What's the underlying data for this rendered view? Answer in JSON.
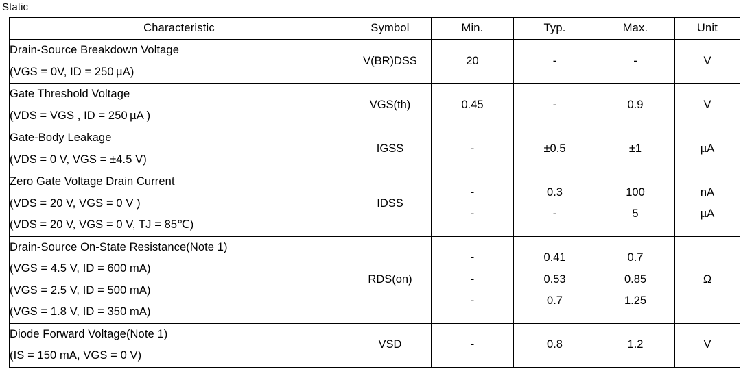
{
  "section": {
    "label": "Static"
  },
  "table": {
    "headers": {
      "characteristic": "Characteristic",
      "symbol": "Symbol",
      "min": "Min.",
      "typ": "Typ.",
      "max": "Max.",
      "unit": "Unit"
    },
    "rows": [
      {
        "characteristic": [
          "Drain-Source Breakdown Voltage",
          "(VGS = 0V, ID = 250 µA)"
        ],
        "symbol": "V(BR)DSS",
        "min": [
          "20"
        ],
        "typ": [
          "-"
        ],
        "max": [
          "-"
        ],
        "unit": [
          "V"
        ]
      },
      {
        "characteristic": [
          "Gate Threshold Voltage",
          "(VDS = VGS , ID = 250 µA )"
        ],
        "symbol": "VGS(th)",
        "min": [
          "0.45"
        ],
        "typ": [
          "-"
        ],
        "max": [
          "0.9"
        ],
        "unit": [
          "V"
        ]
      },
      {
        "characteristic": [
          "Gate-Body Leakage",
          "(VDS = 0 V, VGS = ±4.5 V)"
        ],
        "symbol": "IGSS",
        "min": [
          "-"
        ],
        "typ": [
          "±0.5"
        ],
        "max": [
          "±1"
        ],
        "unit": [
          "µA"
        ]
      },
      {
        "characteristic": [
          "Zero Gate Voltage Drain Current",
          "(VDS = 20 V, VGS = 0 V )",
          "(VDS = 20 V, VGS = 0 V, TJ = 85℃)"
        ],
        "symbol": "IDSS",
        "min": [
          "-",
          "-"
        ],
        "typ": [
          "0.3",
          "-"
        ],
        "max": [
          "100",
          "5"
        ],
        "unit": [
          "nA",
          "µA"
        ]
      },
      {
        "characteristic": [
          "Drain-Source On-State Resistance(Note 1)",
          "(VGS = 4.5 V, ID = 600 mA)",
          "(VGS = 2.5 V, ID = 500 mA)",
          "(VGS = 1.8 V, ID = 350 mA)"
        ],
        "symbol": "RDS(on)",
        "min": [
          "-",
          "-",
          "-"
        ],
        "typ": [
          "0.41",
          "0.53",
          "0.7"
        ],
        "max": [
          "0.7",
          "0.85",
          "1.25"
        ],
        "unit": [
          "Ω"
        ]
      },
      {
        "characteristic": [
          "Diode Forward Voltage(Note 1)",
          "(IS = 150 mA, VGS = 0 V)"
        ],
        "symbol": "VSD",
        "min": [
          "-"
        ],
        "typ": [
          "0.8"
        ],
        "max": [
          "1.2"
        ],
        "unit": [
          "V"
        ]
      }
    ]
  }
}
